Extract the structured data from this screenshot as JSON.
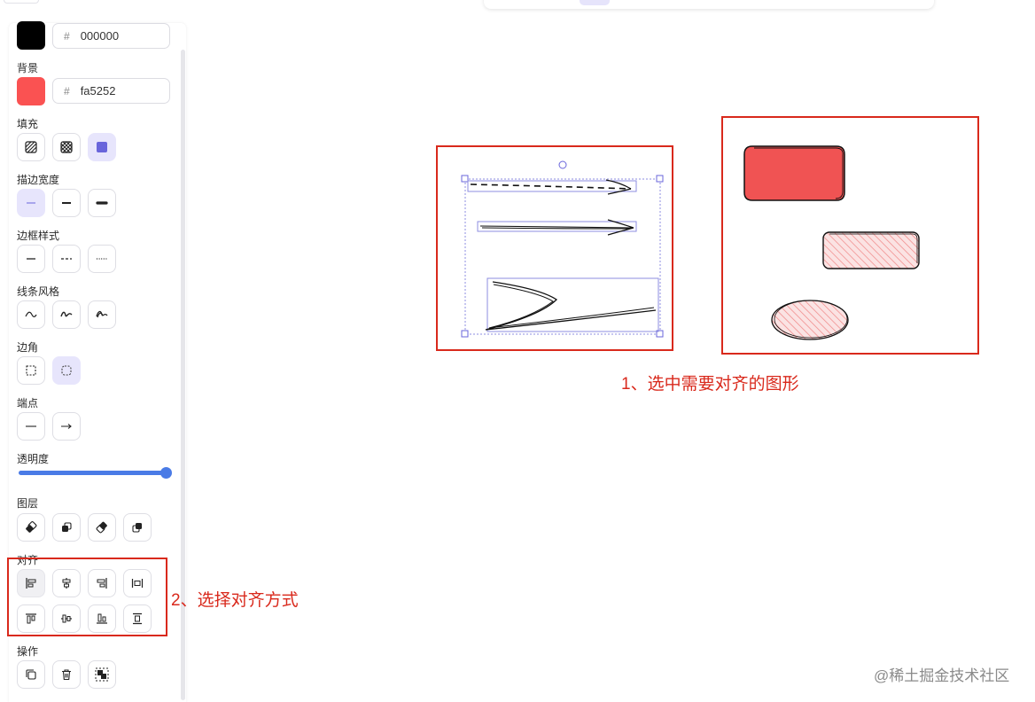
{
  "panel": {
    "stroke_hex": "000000",
    "stroke_color": "#000000",
    "background_label": "背景",
    "background_hex": "fa5252",
    "background_color": "#fa5252",
    "fill_label": "填充",
    "stroke_width_label": "描边宽度",
    "border_style_label": "边框样式",
    "line_style_label": "线条风格",
    "corner_label": "边角",
    "endpoint_label": "端点",
    "opacity_label": "透明度",
    "opacity_value": 100,
    "layer_label": "图层",
    "align_label": "对齐",
    "actions_label": "操作",
    "hash_symbol": "#",
    "accent_color": "#6965db",
    "slider_color": "#4a7be6"
  },
  "annotations": {
    "step1": "1、选中需要对齐的图形",
    "step2": "2、选择对齐方式",
    "color": "#d9291c"
  },
  "watermark": "@稀土掘金技术社区"
}
